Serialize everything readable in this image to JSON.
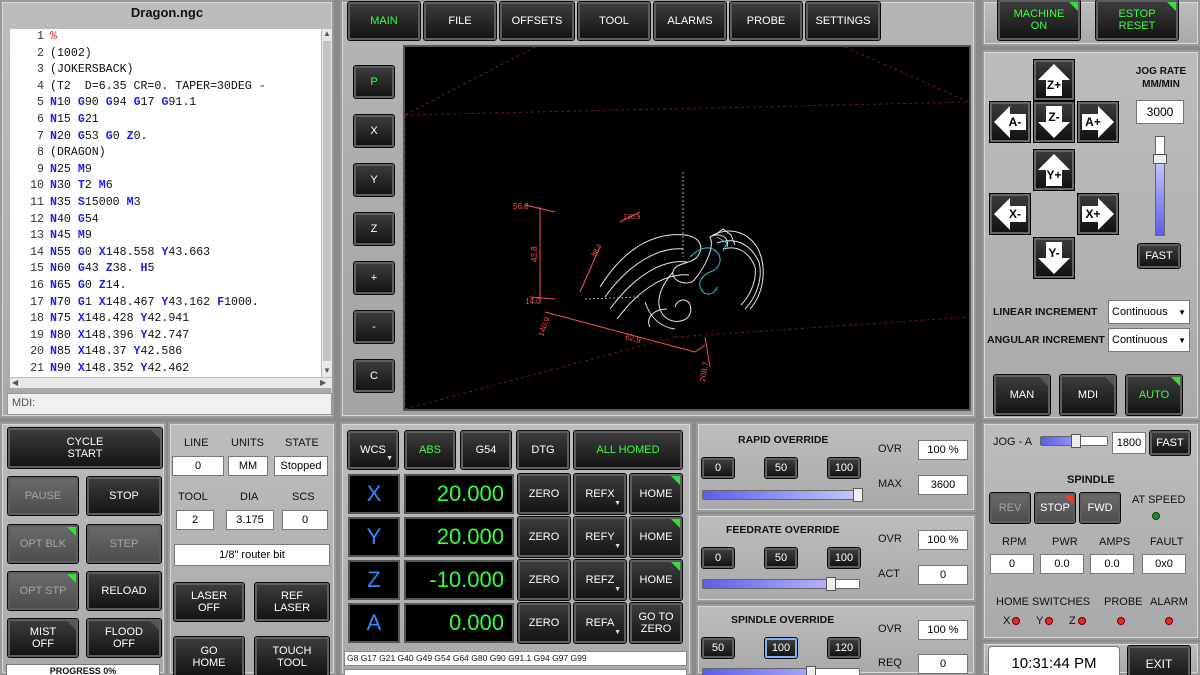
{
  "file_panel": {
    "title": "Dragon.ngc",
    "mdi_label": "MDI:",
    "lines": [
      {
        "n": "1",
        "t": "%"
      },
      {
        "n": "2",
        "t": "(1002)"
      },
      {
        "n": "3",
        "t": "(JOKERSBACK)"
      },
      {
        "n": "4",
        "t": "(T2  D=6.35 CR=0. TAPER=30DEG -"
      },
      {
        "n": "5",
        "t": "N10 G90 G94 G17 G91.1"
      },
      {
        "n": "6",
        "t": "N15 G21"
      },
      {
        "n": "7",
        "t": "N20 G53 G0 Z0."
      },
      {
        "n": "8",
        "t": "(DRAGON)"
      },
      {
        "n": "9",
        "t": "N25 M9"
      },
      {
        "n": "10",
        "t": "N30 T2 M6"
      },
      {
        "n": "11",
        "t": "N35 S15000 M3"
      },
      {
        "n": "12",
        "t": "N40 G54"
      },
      {
        "n": "13",
        "t": "N45 M9"
      },
      {
        "n": "14",
        "t": "N55 G0 X148.558 Y43.663"
      },
      {
        "n": "15",
        "t": "N60 G43 Z38. H5"
      },
      {
        "n": "16",
        "t": "N65 G0 Z14."
      },
      {
        "n": "17",
        "t": "N70 G1 X148.467 Y43.162 F1000."
      },
      {
        "n": "18",
        "t": "N75 X148.428 Y42.941"
      },
      {
        "n": "19",
        "t": "N80 X148.396 Y42.747"
      },
      {
        "n": "20",
        "t": "N85 X148.37 Y42.586"
      },
      {
        "n": "21",
        "t": "N90 X148.352 Y42.462"
      }
    ]
  },
  "top_tabs": [
    "MAIN",
    "FILE",
    "OFFSETS",
    "TOOL",
    "ALARMS",
    "PROBE",
    "SETTINGS"
  ],
  "view_buttons": [
    "P",
    "X",
    "Y",
    "Z",
    "+",
    "-",
    "C"
  ],
  "preview_dims": [
    "56.8",
    "42.8",
    "14.0",
    "140.9",
    "62.9",
    "208.7",
    "130.9",
    "88.1"
  ],
  "machine": {
    "machine_on": "MACHINE ON",
    "estop": "ESTOP RESET"
  },
  "jog": {
    "rate_label": "JOG RATE MM/MIN",
    "rate_value": "3000",
    "fast": "FAST",
    "z_plus": "Z+",
    "z_minus": "Z-",
    "a_minus": "A-",
    "a_plus": "A+",
    "y_plus": "Y+",
    "y_minus": "Y-",
    "x_minus": "X-",
    "x_plus": "X+",
    "linear_label": "LINEAR INCREMENT",
    "linear_value": "Continuous",
    "angular_label": "ANGULAR INCREMENT",
    "angular_value": "Continuous",
    "speed_level": 0.78
  },
  "modes": {
    "man": "MAN",
    "mdi": "MDI",
    "auto": "AUTO"
  },
  "cycle": {
    "cycle_start": "CYCLE START",
    "pause": "PAUSE",
    "stop": "STOP",
    "opt_blk": "OPT BLK",
    "step": "STEP",
    "opt_stp": "OPT STP",
    "reload": "RELOAD",
    "mist_off": "MIST OFF",
    "flood_off": "FLOOD OFF",
    "progress": "PROGRESS 0%"
  },
  "status": {
    "line_label": "LINE",
    "line": "0",
    "units_label": "UNITS",
    "units": "MM",
    "state_label": "STATE",
    "state": "Stopped",
    "tool_label": "TOOL",
    "tool": "2",
    "dia_label": "DIA",
    "dia": "3.175",
    "scs_label": "SCS",
    "scs": "0",
    "tool_desc": "1/8\" router bit",
    "laser_off": "LASER OFF",
    "ref_laser": "REF LASER",
    "go_home": "GO HOME",
    "touch_tool": "TOUCH TOOL"
  },
  "dro": {
    "wcs": "WCS",
    "abs": "ABS",
    "g54": "G54",
    "dtg": "DTG",
    "all_homed": "ALL HOMED",
    "axes": [
      {
        "axis": "X",
        "value": "20.000",
        "zero": "ZERO",
        "ref": "REFX",
        "home": "HOME"
      },
      {
        "axis": "Y",
        "value": "20.000",
        "zero": "ZERO",
        "ref": "REFY",
        "home": "HOME"
      },
      {
        "axis": "Z",
        "value": "-10.000",
        "zero": "ZERO",
        "ref": "REFZ",
        "home": "HOME"
      },
      {
        "axis": "A",
        "value": "0.000",
        "zero": "ZERO",
        "ref": "REFA",
        "home": "GO TO ZERO"
      }
    ],
    "gcodes": "G8 G17 G21 G40 G49 G54 G64 G80 G90 G91.1 G94 G97 G99"
  },
  "overrides": {
    "rapid": {
      "title": "RAPID OVERRIDE",
      "b1": "0",
      "b2": "50",
      "b3": "100",
      "ovr_label": "OVR",
      "ovr": "100 %",
      "max_label": "MAX",
      "max": "3600",
      "level": 1.0
    },
    "feed": {
      "title": "FEEDRATE OVERRIDE",
      "b1": "0",
      "b2": "50",
      "b3": "100",
      "ovr_label": "OVR",
      "ovr": "100 %",
      "act_label": "ACT",
      "act": "0",
      "level": 0.83
    },
    "spindle": {
      "title": "SPINDLE OVERRIDE",
      "b1": "50",
      "b2": "100",
      "b3": "120",
      "ovr_label": "OVR",
      "ovr": "100 %",
      "req_label": "REQ",
      "req": "0",
      "level": 0.7
    }
  },
  "spindle": {
    "jog_a_label": "JOG - A",
    "jog_a_value": "1800",
    "fast": "FAST",
    "jog_a_level": 0.55,
    "title": "SPINDLE",
    "rev": "REV",
    "stop": "STOP",
    "fwd": "FWD",
    "at_speed": "AT SPEED",
    "rpm_label": "RPM",
    "rpm": "0",
    "pwr_label": "PWR",
    "pwr": "0.0",
    "amps_label": "AMPS",
    "amps": "0.0",
    "fault_label": "FAULT",
    "fault": "0x0"
  },
  "switches": {
    "home_label": "HOME SWITCHES",
    "probe_label": "PROBE",
    "alarm_label": "ALARM",
    "x": "X",
    "y": "Y",
    "z": "Z"
  },
  "clock": "10:31:44 PM",
  "exit": "EXIT",
  "colors": {
    "green": "#39ff3f",
    "blue": "#2a8bff",
    "led_red": "#ff2a2a",
    "led_green": "#26d02e"
  }
}
